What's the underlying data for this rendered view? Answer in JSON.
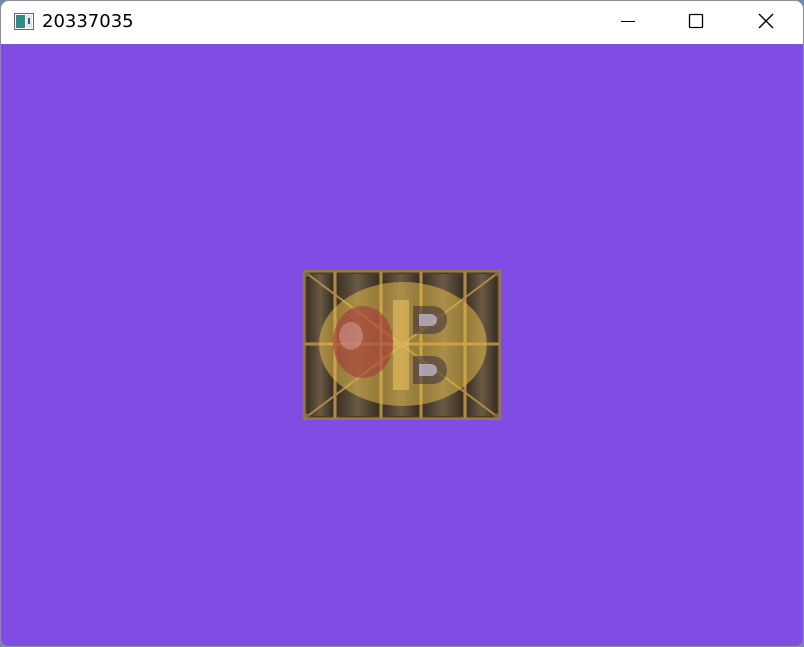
{
  "window": {
    "title": "20337035",
    "client_background": "#804de4"
  },
  "titlebar": {
    "app_icon": "window-app-icon",
    "minimize_icon": "minimize-icon",
    "maximize_icon": "maximize-icon",
    "close_icon": "close-icon"
  },
  "scene": {
    "sprite": "wooden-crate-with-overlaid-logo-texture"
  }
}
